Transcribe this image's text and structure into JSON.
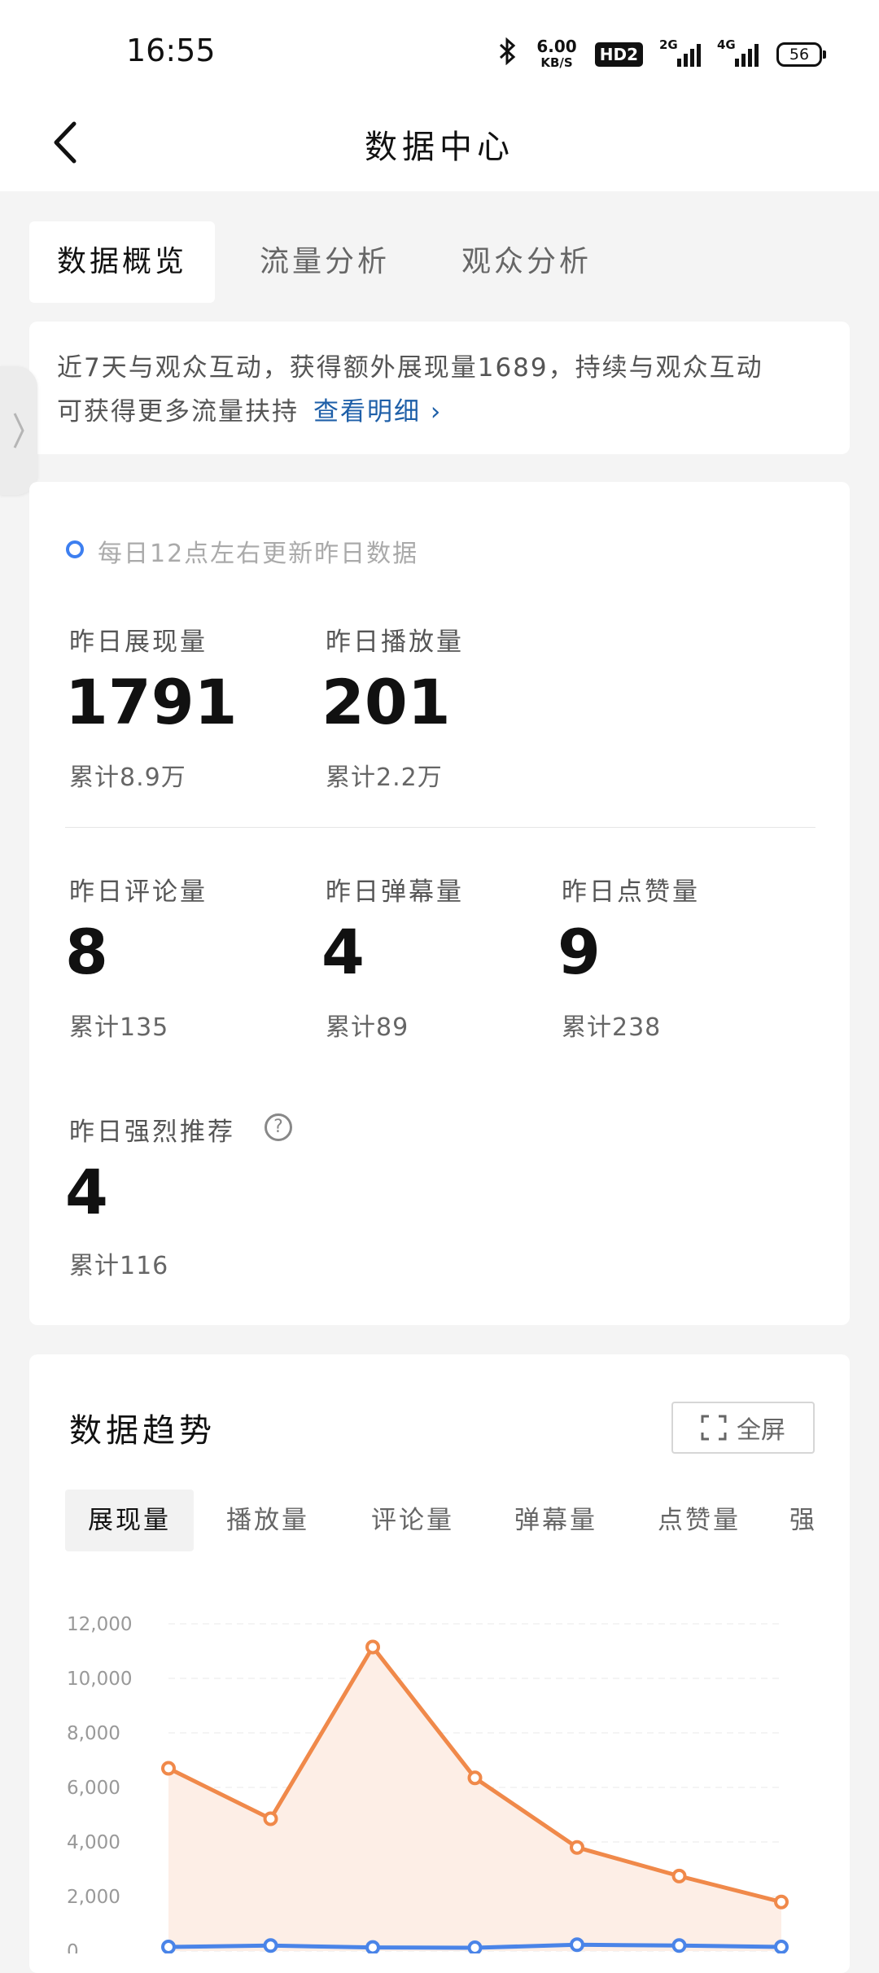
{
  "status_bar": {
    "time": "16:55",
    "net_speed_value": "6.00",
    "net_speed_unit": "KB/S",
    "hd_label": "HD2",
    "signal_1_label": "2G",
    "signal_2_label": "4G",
    "battery": "56",
    "icons": [
      "bluetooth-icon",
      "signal-icon",
      "battery-icon"
    ]
  },
  "header": {
    "title": "数据中心",
    "back_icon": "chevron-left-icon"
  },
  "tabs": [
    {
      "label": "数据概览",
      "active": true
    },
    {
      "label": "流量分析",
      "active": false
    },
    {
      "label": "观众分析",
      "active": false
    }
  ],
  "notice": {
    "line1": "近7天与观众互动，获得额外展现量1689，持续与观众互动",
    "line2": "可获得更多流量扶持",
    "link": "查看明细 ›"
  },
  "stats": {
    "update_note": "每日12点左右更新昨日数据",
    "impressions": {
      "label": "昨日展现量",
      "value": "1791",
      "total": "累计8.9万"
    },
    "plays": {
      "label": "昨日播放量",
      "value": "201",
      "total": "累计2.2万"
    },
    "comments": {
      "label": "昨日评论量",
      "value": "8",
      "total": "累计135"
    },
    "danmaku": {
      "label": "昨日弹幕量",
      "value": "4",
      "total": "累计89"
    },
    "likes": {
      "label": "昨日点赞量",
      "value": "9",
      "total": "累计238"
    },
    "recommend": {
      "label": "昨日强烈推荐",
      "value": "4",
      "total": "累计116",
      "help_icon": "?"
    }
  },
  "trend": {
    "title": "数据趋势",
    "fullscreen_label": "全屏",
    "metric_tabs": [
      {
        "label": "展现量",
        "active": true
      },
      {
        "label": "播放量",
        "active": false
      },
      {
        "label": "评论量",
        "active": false
      },
      {
        "label": "弹幕量",
        "active": false
      },
      {
        "label": "点赞量",
        "active": false
      },
      {
        "label": "强",
        "active": false
      }
    ]
  },
  "chart_data": {
    "type": "line",
    "yticks": [
      "12,000",
      "10,000",
      "8,000",
      "6,000",
      "4,000",
      "2,000",
      "0"
    ],
    "ylim": [
      0,
      12000
    ],
    "grid": true,
    "x": [
      1,
      2,
      3,
      4,
      5,
      6,
      7
    ],
    "series": [
      {
        "color": "#f0894a",
        "fill": "#fdeee6",
        "values": [
          6700,
          4850,
          11150,
          6350,
          3800,
          2750,
          1800
        ]
      },
      {
        "color": "#4a84e8",
        "values": [
          150,
          200,
          130,
          120,
          230,
          200,
          150
        ]
      }
    ]
  },
  "colors": {
    "accent_blue": "#3d7ff0",
    "link_blue": "#1e5fa8",
    "line_orange": "#f0894a"
  }
}
